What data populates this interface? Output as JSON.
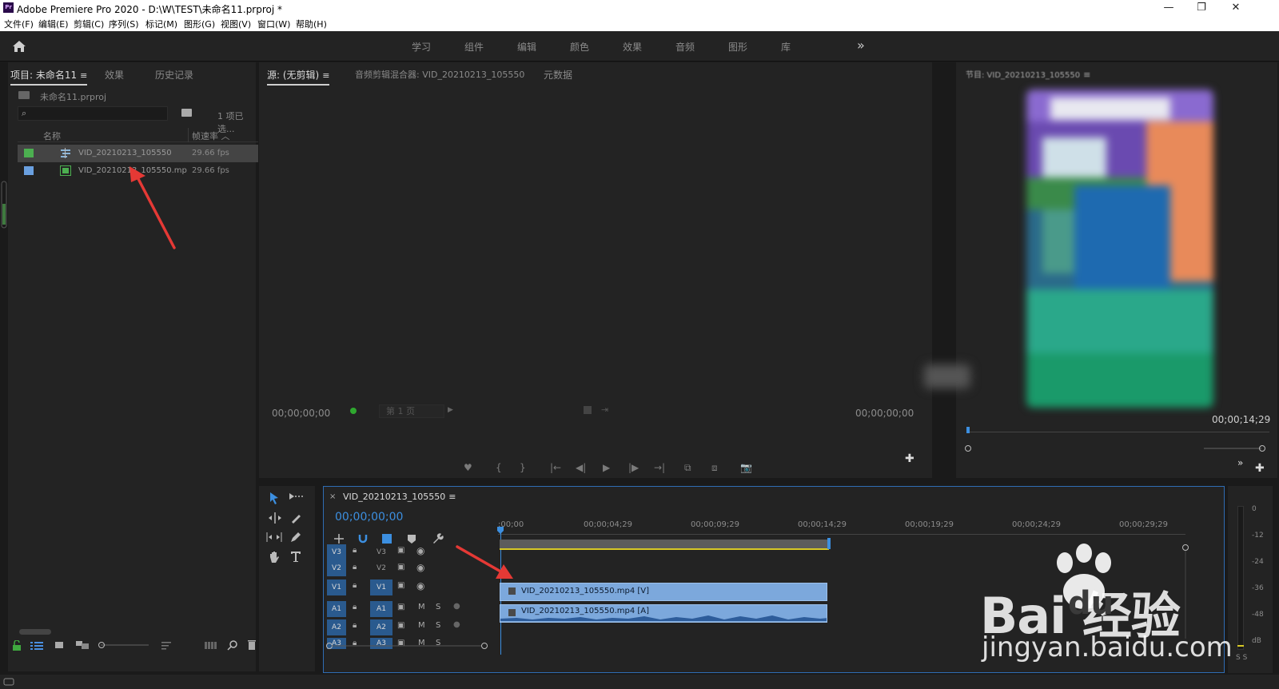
{
  "titlebar": {
    "app_icon_text": "Pr",
    "title": "Adobe Premiere Pro 2020 - D:\\W\\TEST\\未命名11.prproj *",
    "minimize": "—",
    "restore": "❐",
    "close": "✕"
  },
  "menu": [
    "文件(F)",
    "编辑(E)",
    "剪辑(C)",
    "序列(S)",
    "标记(M)",
    "图形(G)",
    "视图(V)",
    "窗口(W)",
    "帮助(H)"
  ],
  "workspaces": {
    "tabs": [
      "学习",
      "组件",
      "编辑",
      "颜色",
      "效果",
      "音频",
      "图形",
      "库"
    ],
    "more": "»"
  },
  "project_panel": {
    "tabs": [
      "项目: 未命名11",
      "效果",
      "历史记录"
    ],
    "menu_glyph": "≡",
    "file": "未命名11.prproj",
    "search_glyph": "⌕",
    "selection_count": "1 项已选...",
    "columns": {
      "name": "名称",
      "fps": "帧速率",
      "sort": "︿"
    },
    "items": [
      {
        "name": "VID_20210213_105550",
        "fps": "29.66 fps",
        "color": "#4caf50",
        "type": "sequence",
        "selected": true
      },
      {
        "name": "VID_20210213_105550.mp",
        "fps": "29.66 fps",
        "color": "#6aa0e0",
        "type": "clip",
        "selected": false
      }
    ]
  },
  "source_monitor": {
    "tabs": [
      "源: (无剪辑)",
      "音频剪辑混合器: VID_20210213_105550",
      "元数据"
    ],
    "menu_glyph": "≡",
    "timecode_left": "00;00;00;00",
    "timecode_right": "00;00;00;00",
    "page_select": "第 1 页",
    "controls": [
      "♥",
      "{",
      "}",
      "|←",
      "◀|",
      "▶",
      "|▶",
      "→|",
      "⧉",
      "⧈",
      "📷"
    ],
    "add": "✚"
  },
  "program_monitor": {
    "tab": "节目: VID_20210213_105550",
    "menu_glyph": "≡",
    "timecode_right": "00;00;14;29",
    "more": "»",
    "add": "✚"
  },
  "timeline": {
    "close": "×",
    "sequence": "VID_20210213_105550",
    "menu_glyph": "≡",
    "timecode": "00;00;00;00",
    "ruler": [
      ":00;00",
      "00;00;04;29",
      "00;00;09;29",
      "00;00;14;29",
      "00;00;19;29",
      "00;00;24;29",
      "00;00;29;29"
    ],
    "video_tracks": [
      "V3",
      "V2",
      "V1"
    ],
    "audio_tracks": [
      "A1",
      "A2",
      "A3"
    ],
    "track_mute": "M",
    "track_solo": "S",
    "clip_video": "VID_20210213_105550.mp4 [V]",
    "clip_audio": "VID_20210213_105550.mp4 [A]"
  },
  "meter": {
    "labels": [
      "0",
      "-12",
      "-24",
      "-36",
      "-48",
      "dB"
    ],
    "solo": "S S"
  },
  "watermark": {
    "main": "Bai  经验",
    "paw": "du",
    "sub": "jingyan.baidu.com"
  }
}
